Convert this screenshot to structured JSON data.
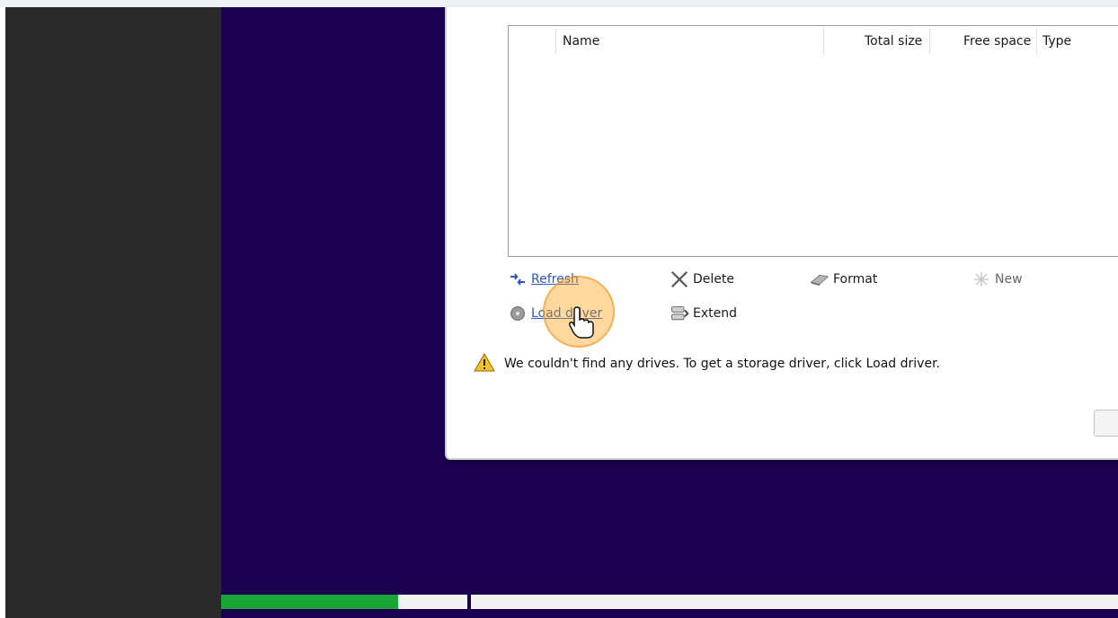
{
  "disk_table": {
    "columns": [
      "Name",
      "Total size",
      "Free space",
      "Type"
    ]
  },
  "actions": {
    "refresh": "Refresh",
    "delete": "Delete",
    "format": "Format",
    "new": "New",
    "load_driver": "Load driver",
    "extend": "Extend"
  },
  "warning_text": "We couldn't find any drives. To get a storage driver, click Load driver.",
  "installation_progress": {
    "step1_fraction": 0.72
  },
  "colors": {
    "setup_background": "#1b0050",
    "progress_fill": "#1aa636",
    "link": "#2b59b6",
    "click_indicator": "#ff9900"
  },
  "icons": {
    "refresh": "refresh-arrows-icon",
    "delete": "delete-x-icon",
    "format": "format-eraser-icon",
    "new": "new-sparkle-icon",
    "load_driver": "load-driver-disc-icon",
    "extend": "extend-drive-icon",
    "warning": "warning-triangle-icon"
  }
}
